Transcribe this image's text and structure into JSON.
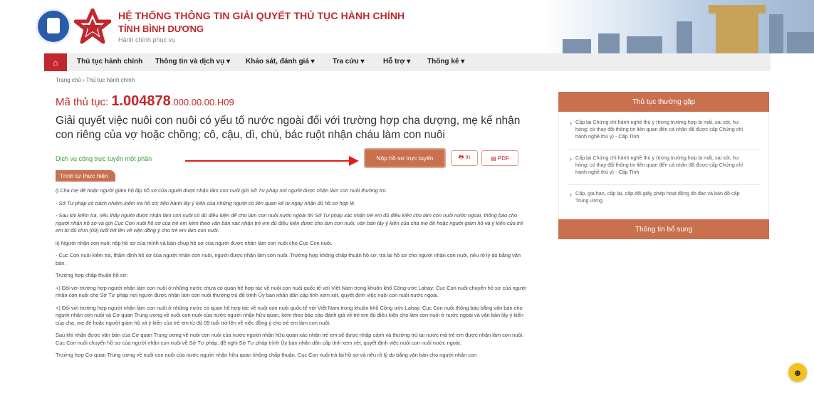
{
  "header": {
    "title": "HỆ THỐNG THÔNG TIN GIẢI QUYẾT THỦ TỤC HÀNH CHÍNH",
    "subtitle": "TỈNH BÌNH DƯƠNG",
    "tagline": "Hành chính phục vụ"
  },
  "nav": {
    "home_icon": "home-icon",
    "items": [
      {
        "label": "Thủ tục hành chính"
      },
      {
        "label": "Thông tin và dịch vụ ▾"
      },
      {
        "label": "Khảo sát, đánh giá ▾"
      },
      {
        "label": "Tra cứu ▾"
      },
      {
        "label": "Hỗ trợ ▾"
      },
      {
        "label": "Thống kê ▾"
      }
    ]
  },
  "breadcrumb": "Trang chủ  ›  Thủ tục hành chính",
  "procedure": {
    "code_prefix": "Mã thủ tục: ",
    "code_main": "1.004878",
    "code_tail": ".000.00.00.H09",
    "title": "Giải quyết việc nuôi con nuôi có yếu tố nước ngoài đối với trường hợp cha dượng, mẹ kế nhận con riêng của vợ hoặc chồng; cô, cậu, dì, chú, bác ruột nhận cháu làm con nuôi",
    "service_level": "Dịch vụ công trực tuyến một phần",
    "submit_label": "Nộp hồ sơ trực tuyến",
    "print_label": "🖶 In",
    "pdf_label": "▤ PDF",
    "section_label": "Trình tự thực hiện"
  },
  "content": {
    "p1": "i) Cha mẹ đẻ hoặc người giám hộ lập hồ sơ của người được nhận làm con nuôi gửi Sở Tư pháp nơi người được nhận làm con nuôi thường trú.",
    "p2": "- Sở Tư pháp có trách nhiệm kiểm tra hồ sơ; tiến hành lấy ý kiến của những người có liên quan kể từ ngày nhận đủ hồ sơ hợp lệ.",
    "p3": "- Sau khi kiểm tra, nếu thấy người được nhận làm con nuôi có đủ điều kiện để cho làm con nuôi nước ngoài thì Sở Tư pháp xác nhận trẻ em đủ điều kiện cho làm con nuôi nước ngoài, thông báo cho người nhận hồ sơ và gửi Cục Con nuôi hồ sơ của trẻ em kèm theo văn bản xác nhận trẻ em đủ điều kiện được cho làm con nuôi, văn bản lấy ý kiến của cha mẹ đẻ hoặc người giám hộ và ý kiến của trẻ em từ đủ chín (09) tuổi trở lên về việc đồng ý cho trẻ em làm con nuôi.",
    "p4": "ii) Người nhận con nuôi nộp hồ sơ của mình và bản chụp hồ sơ của người được nhận làm con nuôi cho Cục Con nuôi.",
    "p5": "- Cục Con nuôi kiểm tra, thẩm định hồ sơ của người nhận con nuôi, người được nhận làm con nuôi. Trường hợp không chấp thuận hồ sơ, trả lại hồ sơ cho người nhận con nuôi, nêu rõ lý do bằng văn bản.",
    "p6": "Trường hợp chấp thuận hồ sơ:",
    "p7": "+) Đối với trường hợp người nhận làm con nuôi ở những nước chưa có quan hệ hợp tác về nuôi con nuôi quốc tế với Việt Nam trong khuôn khổ Công ước Lahay: Cục Con nuôi chuyển hồ sơ của người nhận con nuôi cho Sở Tư pháp nơi người được nhận làm con nuôi thường trú để trình Ủy ban nhân dân cấp tỉnh xem xét, quyết định việc nuôi con nuôi nước ngoài.",
    "p8": "+) Đối với trường hợp người nhận làm con nuôi ở những nước có quan hệ hợp tác về nuôi con nuôi quốc tế với Việt Nam trong khuôn khổ Công ước Lahay: Cục Con nuôi thông báo bằng văn bản cho người nhận con nuôi và Cơ quan Trung ương về nuôi con nuôi của nước người nhận hữu quan, kèm theo báo cáo đánh giá về trẻ em đủ điều kiện cho làm con nuôi ở nước ngoài và văn bản lấy ý kiến của cha, mẹ đẻ hoặc người giám hộ và ý kiến của trẻ em từ đủ 09 tuổi trở lên về việc đồng ý cho trẻ em làm con nuôi.",
    "p9": "Sau khi nhận được văn bản của Cơ quan Trung ương về nuôi con nuôi của nước người nhận hữu quan xác nhận trẻ em sẽ được nhập cảnh và thường trú tại nước mà trẻ em được nhận làm con nuôi, Cục Con nuôi chuyển hồ sơ của người nhận con nuôi về Sở Tư pháp, đề nghị Sở Tư pháp trình Ủy ban nhân dân cấp tỉnh xem xét, quyết định việc nuôi con nuôi nước ngoài.",
    "p10": "Trường hợp Cơ quan Trung ương về nuôi con nuôi của nước người nhận hữu quan không chấp thuận, Cục Con nuôi trả lại hồ sơ và nêu rõ lý do bằng văn bản cho người nhận con"
  },
  "sidebar": {
    "faq_title": "Thủ tục thường gặp",
    "faq": [
      {
        "text": "Cấp lại Chứng chỉ hành nghề thú y (trong trường hợp bị mất, sai sót, hư hỏng; có thay đổi thông tin liên quan đến cá nhân đã được cấp Chứng chỉ hành nghề thú y) - Cấp Tỉnh"
      },
      {
        "text": "Cấp lại Chứng chỉ hành nghề thú y (trong trường hợp bị mất, sai sót, hư hỏng; có thay đổi thông tin liên quan đến cá nhân đã được cấp Chứng chỉ hành nghề thú y) - Cấp Tỉnh"
      },
      {
        "text": "Cấp, gia hạn, cấp lại, cấp đổi giấy phép hoạt động đo đạc và bản đồ cấp Trung ương"
      }
    ],
    "extra_title": "Thông tin bổ sung"
  },
  "colors": {
    "brand_red": "#c0282d",
    "accent_orange": "#c9704f",
    "service_green": "#3d9a3d",
    "annotation_red": "#e01d1d"
  }
}
